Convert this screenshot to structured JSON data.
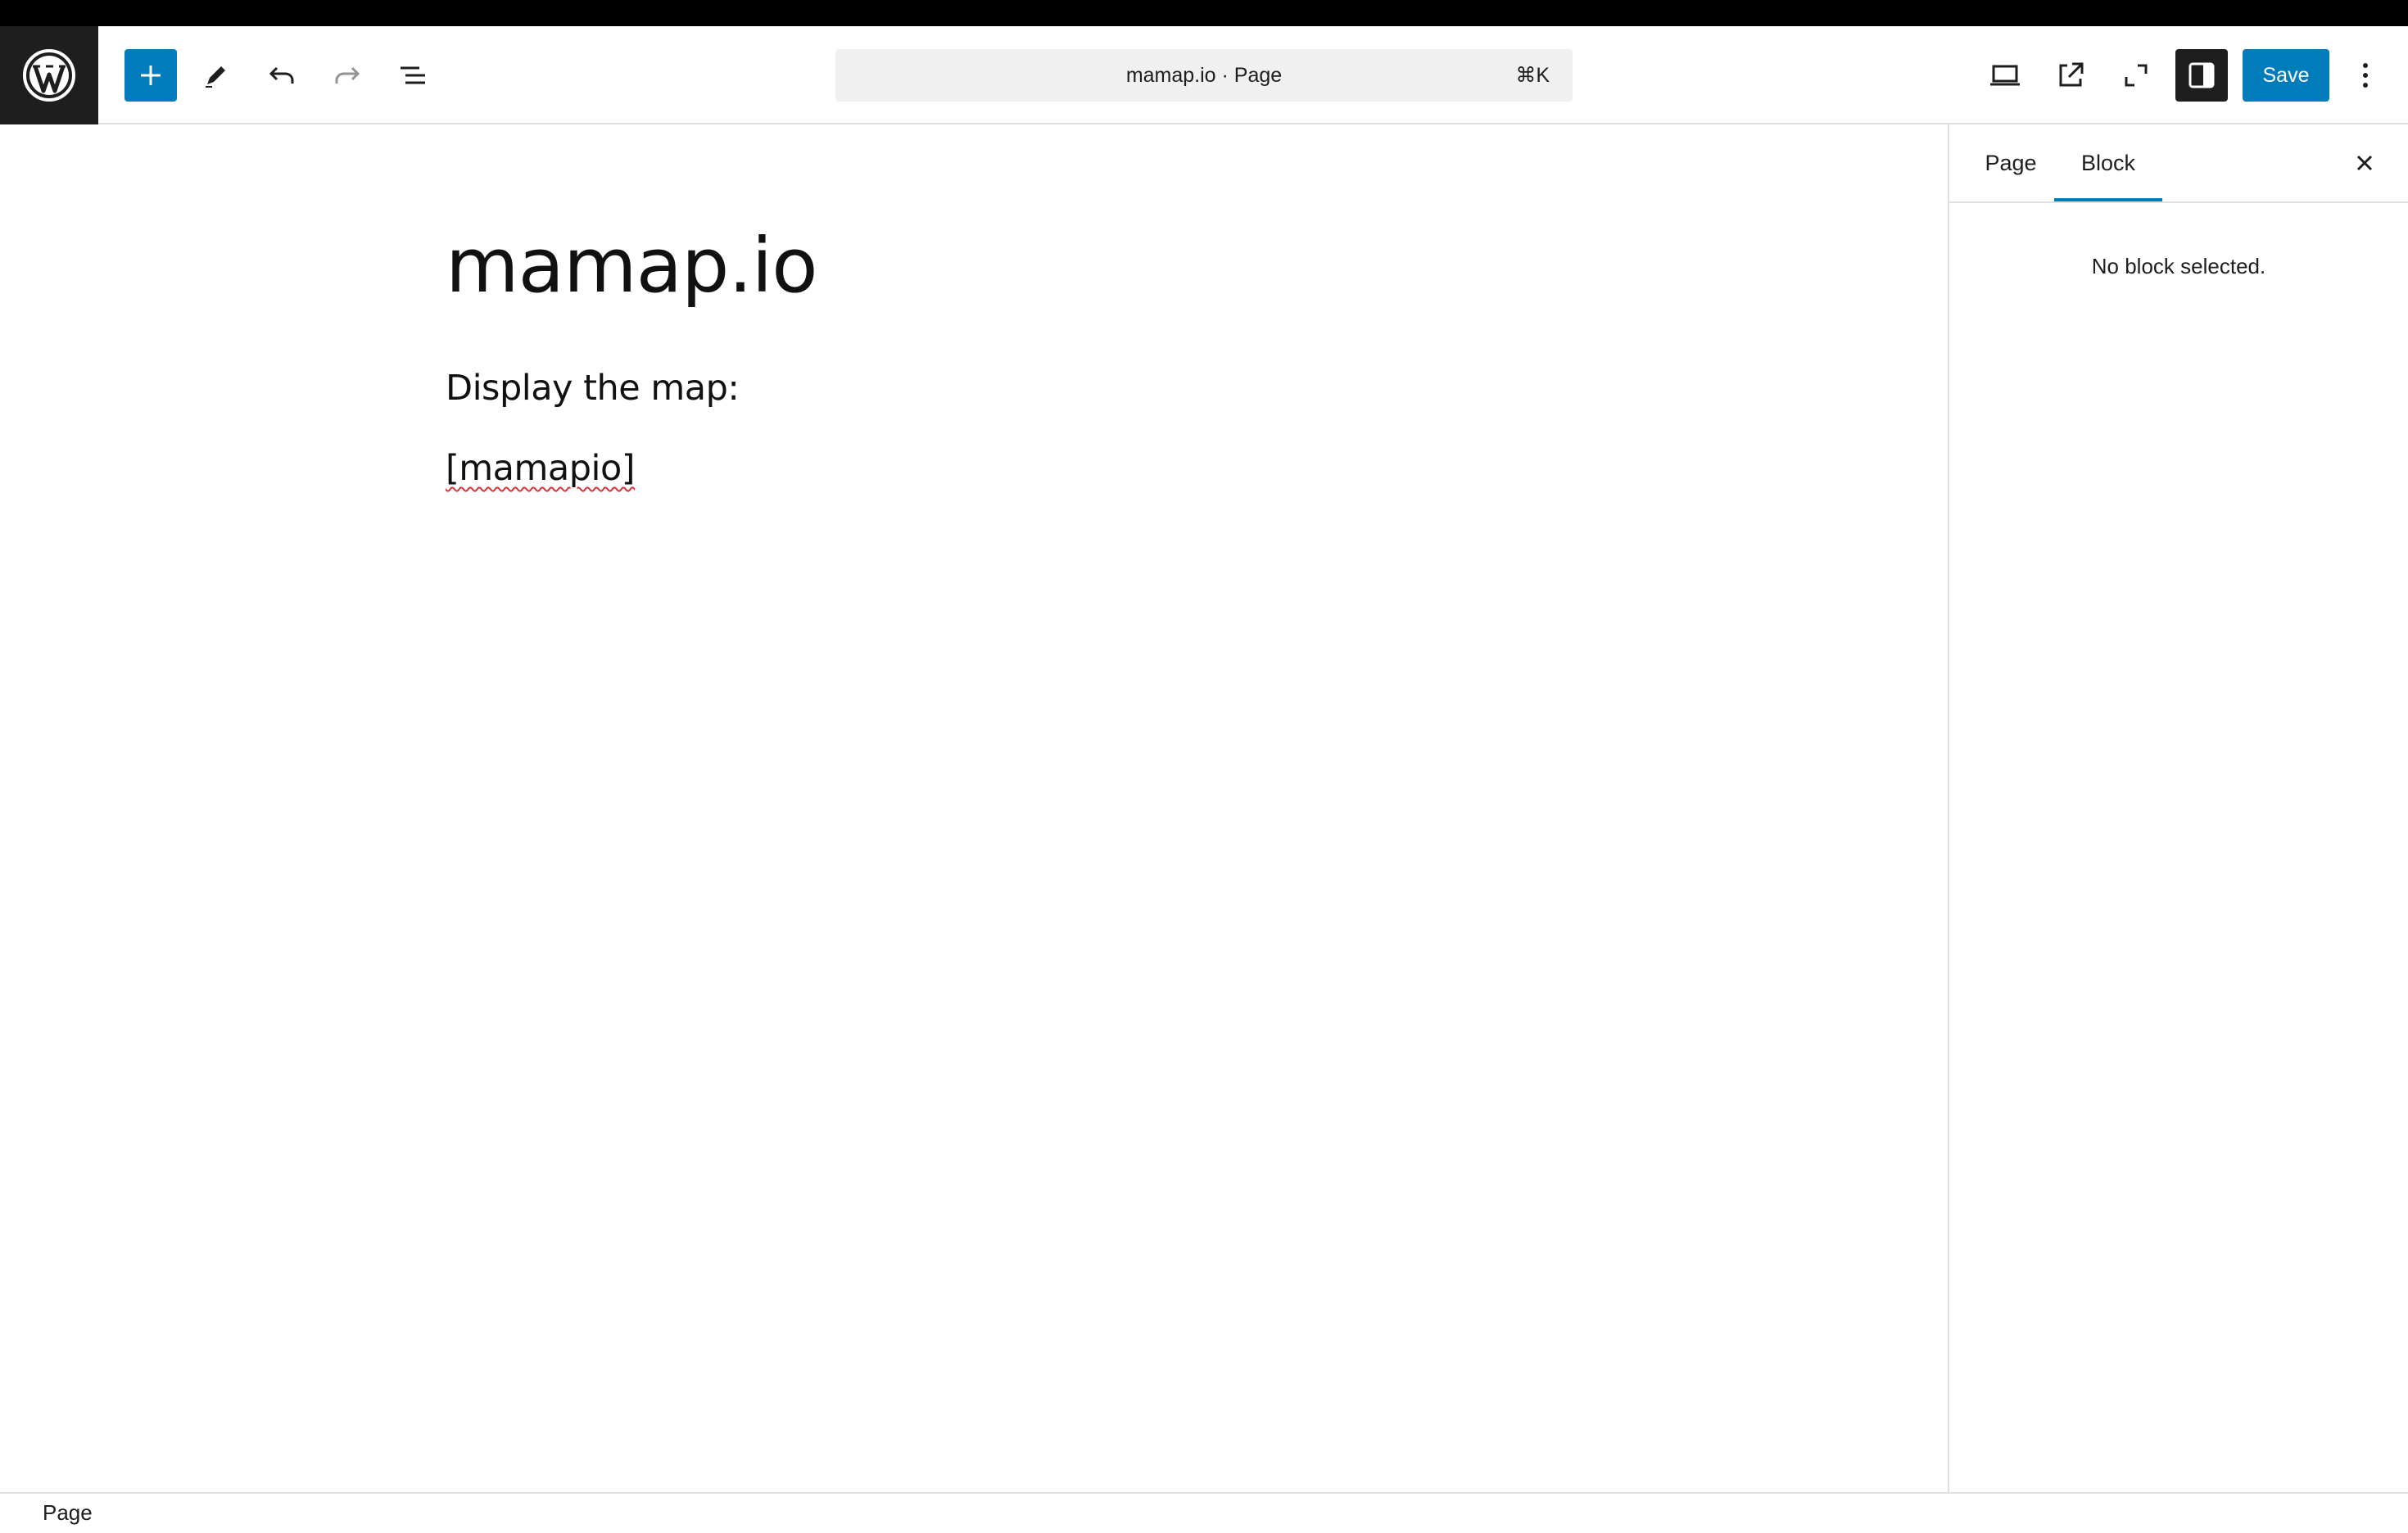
{
  "header": {
    "logo_icon": "wordpress-logo-icon",
    "command_bar": {
      "title": "mamap.io · Page",
      "shortcut": "⌘K"
    },
    "save_label": "Save",
    "accent_color": "#007cba"
  },
  "canvas": {
    "title": "mamap.io",
    "paragraphs": [
      "Display the map:",
      "[mamapio]"
    ]
  },
  "sidebar": {
    "tabs": [
      {
        "label": "Page",
        "active": false
      },
      {
        "label": "Block",
        "active": true
      }
    ],
    "empty_message": "No block selected."
  },
  "footer": {
    "breadcrumb": "Page"
  }
}
